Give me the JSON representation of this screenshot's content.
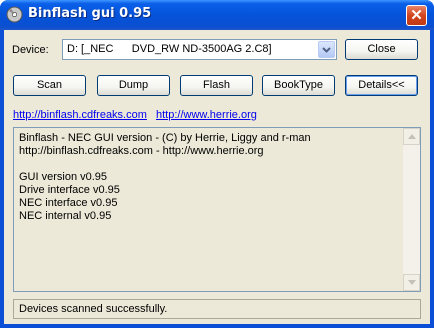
{
  "window": {
    "title": "Binflash gui 0.95",
    "close_glyph": "✕"
  },
  "device": {
    "label": "Device:",
    "selected": "D: [_NEC      DVD_RW ND-3500AG 2.C8]"
  },
  "buttons": {
    "close": "Close",
    "scan": "Scan",
    "dump": "Dump",
    "flash": "Flash",
    "booktype": "BookType",
    "details": "Details<<"
  },
  "links": [
    "http://binflash.cdfreaks.com",
    "http://www.herrie.org"
  ],
  "log": {
    "lines": [
      "Binflash - NEC GUI version - (C) by Herrie, Liggy and r-man",
      "http://binflash.cdfreaks.com - http://www.herrie.org",
      "",
      "GUI version v0.95",
      "Drive interface v0.95",
      "NEC interface v0.95",
      "NEC internal v0.95"
    ]
  },
  "status": {
    "text": "Devices scanned successfully."
  },
  "colors": {
    "titlebar": "#0553da",
    "client": "#ece9d8",
    "link": "#0000ee",
    "close_button": "#d2451d"
  }
}
